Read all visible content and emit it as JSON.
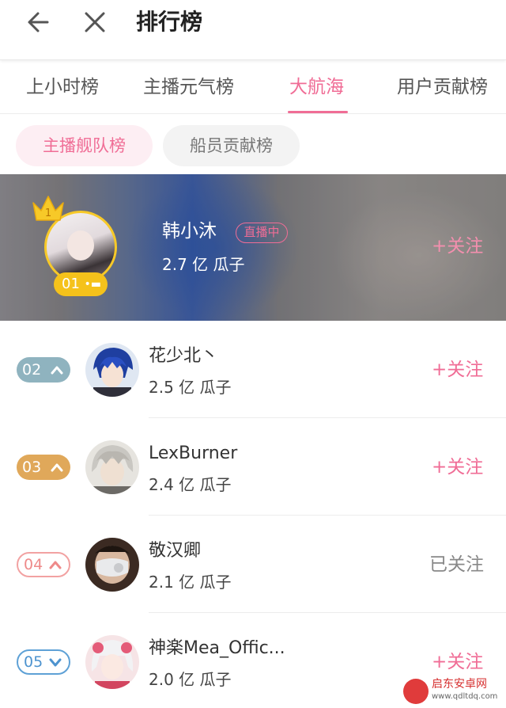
{
  "header": {
    "title": "排行榜"
  },
  "tabs": [
    {
      "label": "上小时榜"
    },
    {
      "label": "主播元气榜"
    },
    {
      "label": "大航海"
    },
    {
      "label": "用户贡献榜"
    }
  ],
  "active_tab": "大航海",
  "subtabs": [
    {
      "label": "主播舰队榜"
    },
    {
      "label": "船员贡献榜"
    }
  ],
  "top": {
    "rank": "01",
    "crown_number": "1",
    "name": "韩小沐",
    "live_label": "直播中",
    "score": "2.7 亿 瓜子",
    "follow": "+关注"
  },
  "rows": [
    {
      "rank": "02",
      "trend": "up",
      "name": "花少北丶",
      "score": "2.5 亿 瓜子",
      "follow": "+关注"
    },
    {
      "rank": "03",
      "trend": "up",
      "name": "LexBurner",
      "score": "2.4 亿 瓜子",
      "follow": "+关注"
    },
    {
      "rank": "04",
      "trend": "up",
      "name": "敬汉卿",
      "score": "2.1 亿 瓜子",
      "follow": "已关注"
    },
    {
      "rank": "05",
      "trend": "down",
      "name": "神楽Mea_Offic...",
      "score": "2.0 亿 瓜子",
      "follow": "+关注"
    }
  ],
  "colors": {
    "accent": "#f06d96",
    "gold": "#f5c21b"
  },
  "watermark": {
    "text": "启东安卓网",
    "url": "www.qdltdq.com"
  }
}
